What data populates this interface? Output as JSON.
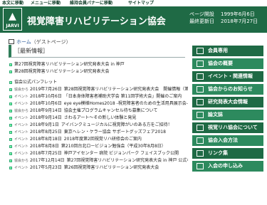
{
  "topbar": {
    "skip_main": "本文に移動",
    "skip_menu": "メニューに移動",
    "skip_banner": "維持会員バナーに移動",
    "sitemap": "サイトマップ"
  },
  "header": {
    "logo_text": "JARVI",
    "title": "視覚障害リハビリテーション協会",
    "opened_label": "ページ開設",
    "opened_date": "1999年6月6日",
    "updated_label": "最終更新日",
    "updated_date": "2018年7月27日"
  },
  "breadcrumb": {
    "home": "ホーム",
    "current": "（ゲストページ）"
  },
  "section_title": "［最新情報］",
  "news": [
    {
      "tag": "",
      "date": "",
      "text": "第27回視覚障害リハビリテーション研究発表大会 in 神戸"
    },
    {
      "tag": "",
      "date": "",
      "text": "第28回視覚障害リハビリテーション研究発表大会"
    },
    {
      "gap": true
    },
    {
      "tag": "",
      "date": "",
      "text": "協会公式パンフレット"
    },
    {
      "tag": "協会から",
      "date": "2019年7月26日",
      "text": "第28回視覚障害リハビリテーション研究発表大会　開催情報（第１報）"
    },
    {
      "tag": "イベント",
      "date": "2018年10月6日",
      "text": "「日本身体障害者補助犬学会 第11回学術大会」開催のご案内"
    },
    {
      "tag": "イベント",
      "date": "2018年10月6日",
      "text": "eye eye模様Homes2018 -視覚障害者のための生活用具展示会-"
    },
    {
      "tag": "協会から",
      "date": "2018年9月14日",
      "text": "協会主催プログラムキャンセル待ち募集について"
    },
    {
      "tag": "イベント",
      "date": "2018年9月14日",
      "text": "さわるアート〜その新しい体験と発見"
    },
    {
      "tag": "イベント",
      "date": "2018年9月1日",
      "text": "アイバンクミュージカルに視覚障がいのある方をご招待！"
    },
    {
      "tag": "イベント",
      "date": "2018年8月25日",
      "text": "東京ヘレン・ケラー協会 サポートグッズフェア2018"
    },
    {
      "tag": "イベント",
      "date": "2018年8月18日",
      "text": "2018年度第2回視覚リハ研修会のご案内"
    },
    {
      "tag": "イベント",
      "date": "2018年8月8日",
      "text": "第210回台北ロービジョン勉強会（平成30年8月8日）"
    },
    {
      "tag": "イベント",
      "date": "2018年7月25日",
      "text": "神戸アイセンター 病院 ビジョンパーク フェイスブック公開"
    },
    {
      "tag": "協会から",
      "date": "2017年12月14日",
      "text": "第27回視覚障害リハビリテーション研究発表大会 in 神戸 公式ホームページ公開"
    },
    {
      "tag": "イベント",
      "date": "2017年5月23日",
      "text": "第26回視覚障害リハビリテーション研究発表大会"
    }
  ],
  "side_menu": [
    {
      "label": "会員専用",
      "icon": "lock-icon"
    },
    {
      "label": "協会の概要",
      "icon": "info-icon"
    },
    {
      "label": "イベント・関連情報",
      "icon": "calendar-icon"
    },
    {
      "label": "協会からのお知らせ",
      "icon": "megaphone-icon"
    },
    {
      "label": "研究発表大会情報",
      "icon": "book-icon"
    },
    {
      "label": "論文誌",
      "icon": "document-icon"
    },
    {
      "label": "視覚リハ協会について",
      "icon": "people-icon"
    },
    {
      "label": "協会入会方法",
      "icon": "person-add-icon"
    },
    {
      "label": "リンク集",
      "icon": "link-icon"
    },
    {
      "label": "入会の申し込み",
      "icon": "form-icon"
    }
  ]
}
